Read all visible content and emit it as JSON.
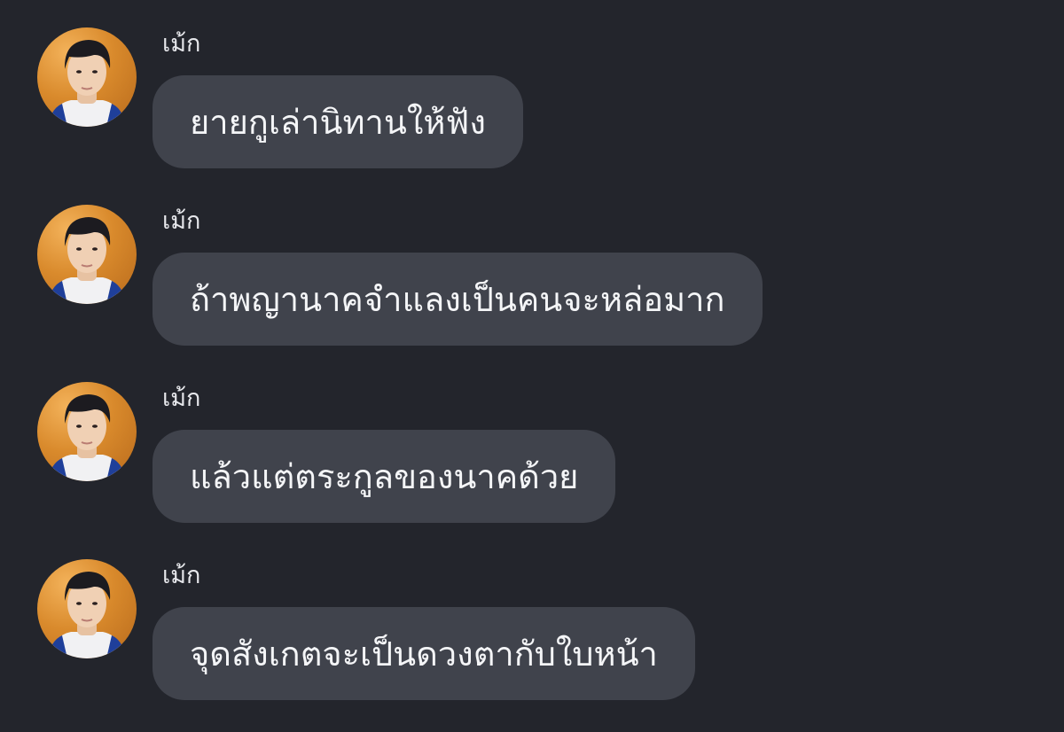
{
  "chat": {
    "messages": [
      {
        "sender": "เม้ก",
        "text": "ยายกูเล่านิทานให้ฟัง"
      },
      {
        "sender": "เม้ก",
        "text": "ถ้าพญานาคจำแลงเป็นคนจะหล่อมาก"
      },
      {
        "sender": "เม้ก",
        "text": "แล้วแต่ตระกูลของนาคด้วย"
      },
      {
        "sender": "เม้ก",
        "text": "จุดสังเกตจะเป็นดวงตากับใบหน้า"
      }
    ]
  },
  "colors": {
    "background": "#23252c",
    "bubble": "#40434c",
    "text": "#f4f5f7",
    "sender_text": "#e7e8ec",
    "avatar_bg": "#d98a2c"
  }
}
